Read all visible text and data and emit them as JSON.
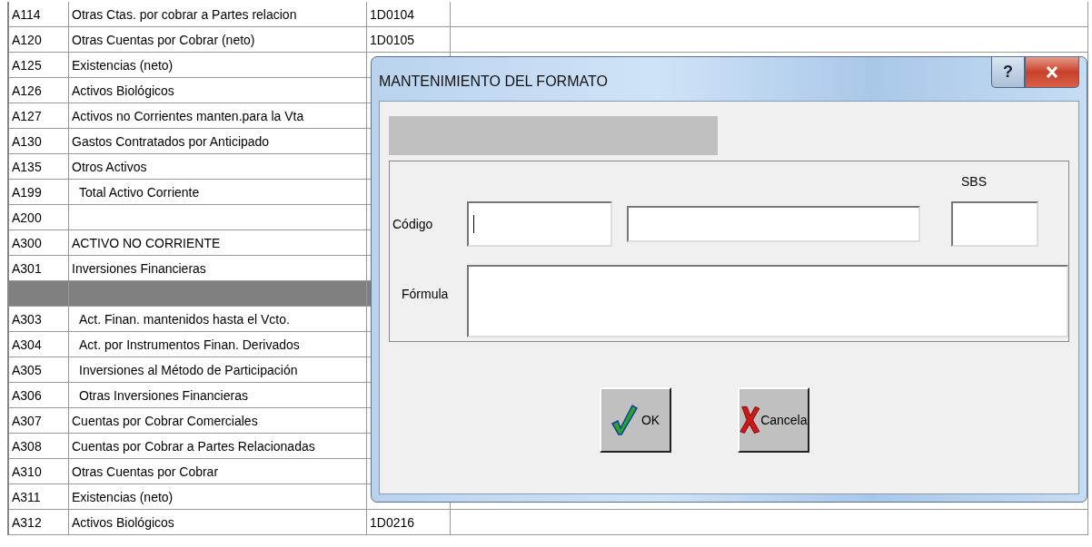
{
  "table": {
    "rows": [
      {
        "column_1": "A114",
        "column_2": "Otras Ctas. por cobrar a Partes relacion",
        "column_3": "1D0104",
        "selected": false,
        "indented": false
      },
      {
        "column_1": "A120",
        "column_2": "Otras Cuentas por Cobrar (neto)",
        "column_3": "1D0105",
        "selected": false,
        "indented": false
      },
      {
        "column_1": "A125",
        "column_2": "Existencias (neto)",
        "selected": false,
        "indented": false
      },
      {
        "column_1": "A126",
        "column_2": "Activos Biológicos",
        "selected": false,
        "indented": false
      },
      {
        "column_1": "A127",
        "column_2": "Activos no Corrientes manten.para la Vta",
        "selected": false,
        "indented": false
      },
      {
        "column_1": "A130",
        "column_2": "Gastos Contratados por Anticipado",
        "selected": false,
        "indented": false
      },
      {
        "column_1": "A135",
        "column_2": "Otros Activos",
        "selected": false,
        "indented": false
      },
      {
        "column_1": "A199",
        "column_2": "Total Activo Corriente",
        "selected": false,
        "indented": true
      },
      {
        "column_1": "A200",
        "selected": false
      },
      {
        "column_1": "A300",
        "column_2": "ACTIVO NO CORRIENTE",
        "selected": false,
        "indented": false
      },
      {
        "column_1": "A301",
        "column_2": "Inversiones Financieras",
        "selected": false,
        "indented": false
      },
      {
        "selected": true
      },
      {
        "column_1": "A303",
        "column_2": "Act. Finan. mantenidos hasta el Vcto.",
        "selected": false,
        "indented": true
      },
      {
        "column_1": "A304",
        "column_2": "Act. por Instrumentos Finan. Derivados",
        "selected": false,
        "indented": true
      },
      {
        "column_1": "A305",
        "column_2": "Inversiones al Método de Participación",
        "selected": false,
        "indented": true
      },
      {
        "column_1": "A306",
        "column_2": "Otras Inversiones Financieras",
        "selected": false,
        "indented": true
      },
      {
        "column_1": "A307",
        "column_2": "Cuentas por Cobrar Comerciales",
        "selected": false,
        "indented": false
      },
      {
        "column_1": "A308",
        "column_2": "Cuentas por Cobrar a Partes Relacionadas",
        "selected": false,
        "indented": false
      },
      {
        "column_1": "A310",
        "column_2": "Otras Cuentas por Cobrar",
        "selected": false,
        "indented": false
      },
      {
        "column_1": "A311",
        "column_2": "Existencias (neto)",
        "selected": false,
        "indented": false
      },
      {
        "column_1": "A312",
        "column_2": "Activos Biológicos",
        "column_3": "1D0216",
        "selected": false,
        "indented": false
      }
    ]
  },
  "dialog": {
    "title": "MANTENIMIENTO DEL FORMATO",
    "help_button": "?",
    "fields": {
      "codigo_label": "Código",
      "sbs_label": "SBS",
      "formula_label": "Fórmula",
      "codigo_focused": true
    },
    "buttons": [
      {
        "label": "OK",
        "kind": "ok"
      },
      {
        "label": "Cancela",
        "kind": "cancel"
      }
    ]
  }
}
